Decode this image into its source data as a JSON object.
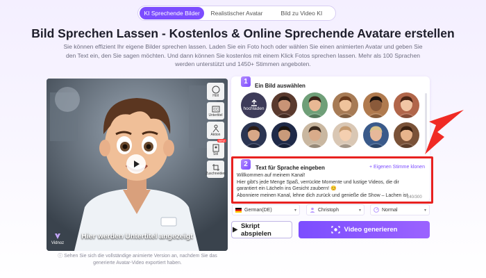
{
  "tabs": [
    {
      "label": "KI Sprechende Bilder",
      "active": true
    },
    {
      "label": "Realistischer Avatar",
      "active": false
    },
    {
      "label": "Bild zu Video KI",
      "active": false
    }
  ],
  "heading": "Bild Sprechen Lassen  -  Kostenlos & Online Sprechende Avatare erstellen",
  "description": "Sie können effizient Ihr eigene Bilder sprechen lassen. Laden Sie ein Foto hoch oder wählen Sie einen animierten Avatar und geben Sie den Text ein, den Sie sagen möchten. Und dann können Sie kostenlos mit einem Klick Fotos sprechen lassen. Mehr als 100 Sprachen werden unterstützt und 1450+ Stimmen angeboten.",
  "video": {
    "subtitle": "Hier werden Untertitel angezeigt",
    "logo_label": "Vidnoz",
    "side_tools": [
      {
        "label": "Höll",
        "icon": "face-icon",
        "badge": ""
      },
      {
        "label": "Untertitel",
        "icon": "cc-icon",
        "badge": ""
      },
      {
        "label": "Aktion",
        "icon": "person-action-icon",
        "badge": ""
      },
      {
        "label": "Stil",
        "icon": "style-icon",
        "badge": "NEW"
      },
      {
        "label": "Zuschneiden",
        "icon": "crop-icon",
        "badge": ""
      }
    ],
    "note": "Sehen Sie sich die vollständige animierte Version an, nachdem Sie das generierte Avatar-Video exportiert haben."
  },
  "step1": {
    "number": "1",
    "title": "Ein Bild auswählen",
    "upload_label": "hochladen",
    "avatars": [
      {
        "name": "avatar-woman-dark-hair",
        "bg": "#5a3a2e",
        "skin": "#c89476",
        "hair": "#2a1a14"
      },
      {
        "name": "avatar-cartoon-boy-green",
        "bg": "#6f9f78",
        "skin": "#e9b894",
        "hair": "#3a2418"
      },
      {
        "name": "avatar-cartoon-boy-brown",
        "bg": "#a77b55",
        "skin": "#f0c39c",
        "hair": "#6a3a1c"
      },
      {
        "name": "avatar-cartoon-man-dark",
        "bg": "#b07a4e",
        "skin": "#8a5a3a",
        "hair": "#1c120c"
      },
      {
        "name": "avatar-cartoon-girl",
        "bg": "#b1664a",
        "skin": "#f1c6a4",
        "hair": "#4a2414"
      },
      {
        "name": "avatar-news-woman",
        "bg": "#2b3552",
        "skin": "#d8a888",
        "hair": "#2b1c14"
      },
      {
        "name": "avatar-news-man",
        "bg": "#1f2a48",
        "skin": "#c99a7a",
        "hair": "#1a1410"
      },
      {
        "name": "avatar-man-beige",
        "bg": "#c9b7a0",
        "skin": "#d9ab8a",
        "hair": "#3a2a1e"
      },
      {
        "name": "avatar-baby",
        "bg": "#d9c7b4",
        "skin": "#f4cfb0",
        "hair": "#c49a70"
      },
      {
        "name": "avatar-man-suit",
        "bg": "#3a5a8a",
        "skin": "#e6b89a",
        "hair": "#d9c28a"
      },
      {
        "name": "avatar-cartoon-kid",
        "bg": "#7a5238",
        "skin": "#e8b48c",
        "hair": "#3a2010"
      }
    ]
  },
  "step2": {
    "number": "2",
    "title": "Text für Sprache eingeben",
    "own_voice": "+ Eigenen Stimme klonen",
    "text_lines": [
      "Willkommen auf meinem Kanal!",
      "Hier gibt's jede Menge Spaß, verrückte Momente und lustige Videos, die dir",
      "garantiert ein Lächeln ins Gesicht zaubern! 😊",
      "Abonniere meinen Kanal, lehne dich zurück und genieße die Show – Lachen ist"
    ],
    "counter": "240/300"
  },
  "selects": {
    "language": "German(DE)",
    "voice": "Christoph",
    "speed": "Normal"
  },
  "buttons": {
    "play_script": "Skript abspielen",
    "generate": "Video generieren"
  },
  "colors": {
    "accent": "#7c4dff",
    "highlight": "#e8211f"
  }
}
